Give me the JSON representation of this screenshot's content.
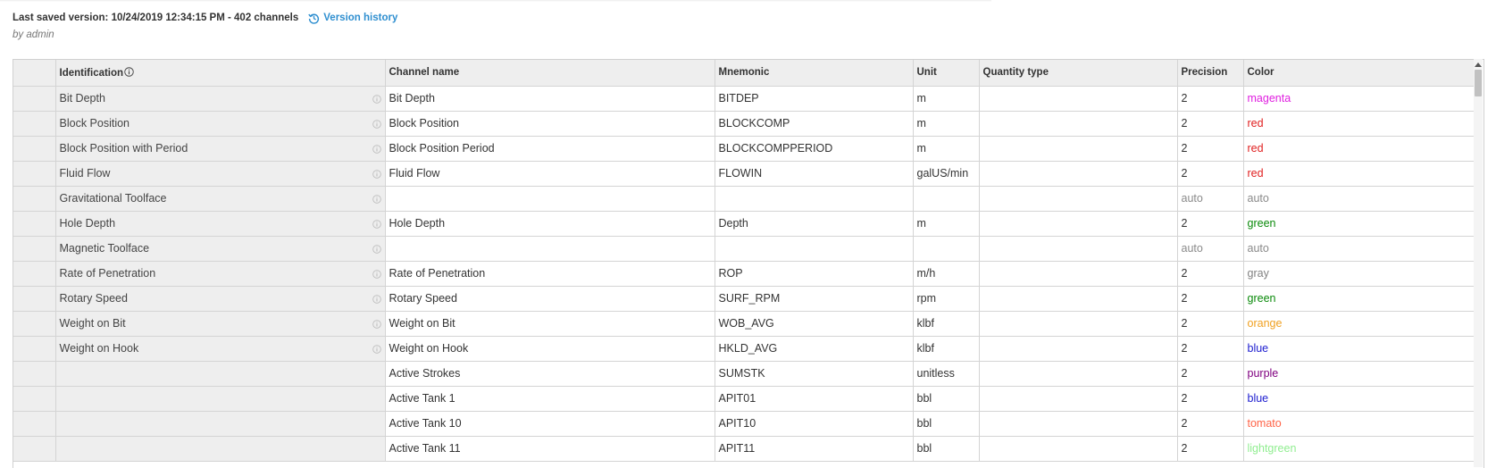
{
  "header": {
    "saved_text": "Last saved version: 10/24/2019 12:34:15 PM - 402 channels",
    "version_history_label": "Version history",
    "by_text": "by admin"
  },
  "grid": {
    "columns": [
      "",
      "Identification",
      "Channel name",
      "Mnemonic",
      "Unit",
      "Quantity type",
      "Precision",
      "Color"
    ],
    "rows": [
      {
        "identification": "Bit Depth",
        "channel_name": "Bit Depth",
        "mnemonic": "BITDEP",
        "unit": "m",
        "quantity_type": "",
        "precision": "2",
        "color": "magenta",
        "color_hex": "#e020e0"
      },
      {
        "identification": "Block Position",
        "channel_name": "Block Position",
        "mnemonic": "BLOCKCOMP",
        "unit": "m",
        "quantity_type": "",
        "precision": "2",
        "color": "red",
        "color_hex": "#e02020"
      },
      {
        "identification": "Block Position with Period",
        "channel_name": "Block Position Period",
        "mnemonic": "BLOCKCOMPPERIOD",
        "unit": "m",
        "quantity_type": "",
        "precision": "2",
        "color": "red",
        "color_hex": "#e02020"
      },
      {
        "identification": "Fluid Flow",
        "channel_name": "Fluid Flow",
        "mnemonic": "FLOWIN",
        "unit": "galUS/min",
        "quantity_type": "",
        "precision": "2",
        "color": "red",
        "color_hex": "#e02020"
      },
      {
        "identification": "Gravitational Toolface",
        "channel_name": "",
        "mnemonic": "",
        "unit": "",
        "quantity_type": "",
        "precision": "auto",
        "color": "auto",
        "color_hex": "#8a8a8a"
      },
      {
        "identification": "Hole Depth",
        "channel_name": "Hole Depth",
        "mnemonic": "Depth",
        "unit": "m",
        "quantity_type": "",
        "precision": "2",
        "color": "green",
        "color_hex": "#0a8a0a"
      },
      {
        "identification": "Magnetic Toolface",
        "channel_name": "",
        "mnemonic": "",
        "unit": "",
        "quantity_type": "",
        "precision": "auto",
        "color": "auto",
        "color_hex": "#8a8a8a"
      },
      {
        "identification": "Rate of Penetration",
        "channel_name": "Rate of Penetration",
        "mnemonic": "ROP",
        "unit": "m/h",
        "quantity_type": "",
        "precision": "2",
        "color": "gray",
        "color_hex": "#808080"
      },
      {
        "identification": "Rotary Speed",
        "channel_name": "Rotary Speed",
        "mnemonic": "SURF_RPM",
        "unit": "rpm",
        "quantity_type": "",
        "precision": "2",
        "color": "green",
        "color_hex": "#0a8a0a"
      },
      {
        "identification": "Weight on Bit",
        "channel_name": "Weight on Bit",
        "mnemonic": "WOB_AVG",
        "unit": "klbf",
        "quantity_type": "",
        "precision": "2",
        "color": "orange",
        "color_hex": "#f0a020"
      },
      {
        "identification": "Weight on Hook",
        "channel_name": "Weight on Hook",
        "mnemonic": "HKLD_AVG",
        "unit": "klbf",
        "quantity_type": "",
        "precision": "2",
        "color": "blue",
        "color_hex": "#2020d0"
      },
      {
        "identification": "",
        "channel_name": "Active Strokes",
        "mnemonic": "SUMSTK",
        "unit": "unitless",
        "quantity_type": "",
        "precision": "2",
        "color": "purple",
        "color_hex": "#800080"
      },
      {
        "identification": "",
        "channel_name": "Active Tank 1",
        "mnemonic": "APIT01",
        "unit": "bbl",
        "quantity_type": "",
        "precision": "2",
        "color": "blue",
        "color_hex": "#2020d0"
      },
      {
        "identification": "",
        "channel_name": "Active Tank 10",
        "mnemonic": "APIT10",
        "unit": "bbl",
        "quantity_type": "",
        "precision": "2",
        "color": "tomato",
        "color_hex": "#ff6347"
      },
      {
        "identification": "",
        "channel_name": "Active Tank 11",
        "mnemonic": "APIT11",
        "unit": "bbl",
        "quantity_type": "",
        "precision": "2",
        "color": "lightgreen",
        "color_hex": "#90ee90"
      }
    ]
  }
}
